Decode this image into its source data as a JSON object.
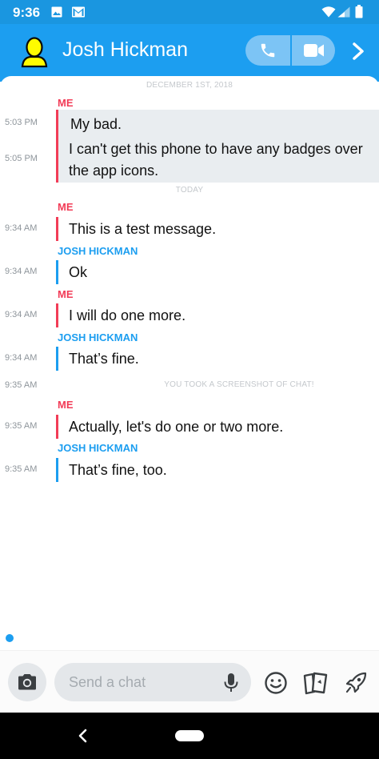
{
  "status_bar": {
    "time": "9:36"
  },
  "header": {
    "title": "Josh Hickman"
  },
  "chat": {
    "date_separators": [
      "DECEMBER 1ST, 2018",
      "TODAY"
    ],
    "screenshot_notice": "YOU TOOK A SCREENSHOT OF CHAT!",
    "screenshot_time": "9:35 AM",
    "messages": [
      {
        "sender": "ME",
        "time": "5:03 PM",
        "text": "My bad."
      },
      {
        "sender": "",
        "time": "5:05 PM",
        "text_line1": "I can't get this phone to have any badges over",
        "text_line2": "the app icons."
      },
      {
        "sender": "ME",
        "time": "9:34 AM",
        "text": "This is a test message."
      },
      {
        "sender": "JOSH HICKMAN",
        "time": "9:34 AM",
        "text": "Ok"
      },
      {
        "sender": "ME",
        "time": "9:34 AM",
        "text": "I will do one more."
      },
      {
        "sender": "JOSH HICKMAN",
        "time": "9:34 AM",
        "text": "That’s fine."
      },
      {
        "sender": "ME",
        "time": "9:35 AM",
        "text": "Actually, let's do one or two more."
      },
      {
        "sender": "JOSH HICKMAN",
        "time": "9:35 AM",
        "text": "That’s fine, too."
      }
    ]
  },
  "input": {
    "placeholder": "Send a chat",
    "value": ""
  },
  "icons": [
    "camera-icon",
    "microphone-icon",
    "emoji-icon",
    "cards-icon",
    "rocket-icon",
    "phone-icon",
    "video-icon",
    "chevron-right-icon",
    "back-icon"
  ],
  "colors": {
    "brand": "#1c9ef0",
    "me": "#f23c57",
    "highlight": "#e9edf0"
  }
}
